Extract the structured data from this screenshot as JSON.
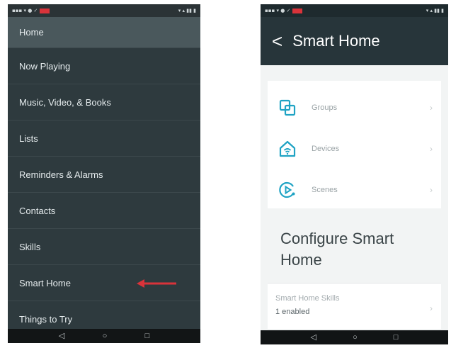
{
  "left": {
    "menu": [
      {
        "label": "Home"
      },
      {
        "label": "Now Playing"
      },
      {
        "label": "Music, Video, & Books"
      },
      {
        "label": "Lists"
      },
      {
        "label": "Reminders & Alarms"
      },
      {
        "label": "Contacts"
      },
      {
        "label": "Skills"
      },
      {
        "label": "Smart Home"
      },
      {
        "label": "Things to Try"
      }
    ],
    "arrow_color": "#d9333a"
  },
  "right": {
    "header": {
      "back": "<",
      "title": "Smart Home"
    },
    "rows": [
      {
        "label": "Groups",
        "icon": "groups-icon"
      },
      {
        "label": "Devices",
        "icon": "devices-icon"
      },
      {
        "label": "Scenes",
        "icon": "scenes-icon"
      }
    ],
    "section_title": "Configure Smart Home",
    "skills": {
      "title": "Smart Home Skills",
      "subtitle": "1 enabled"
    },
    "accent_color": "#1fa3c4"
  },
  "nav": {
    "back": "◁",
    "home": "○",
    "recent": "□"
  }
}
